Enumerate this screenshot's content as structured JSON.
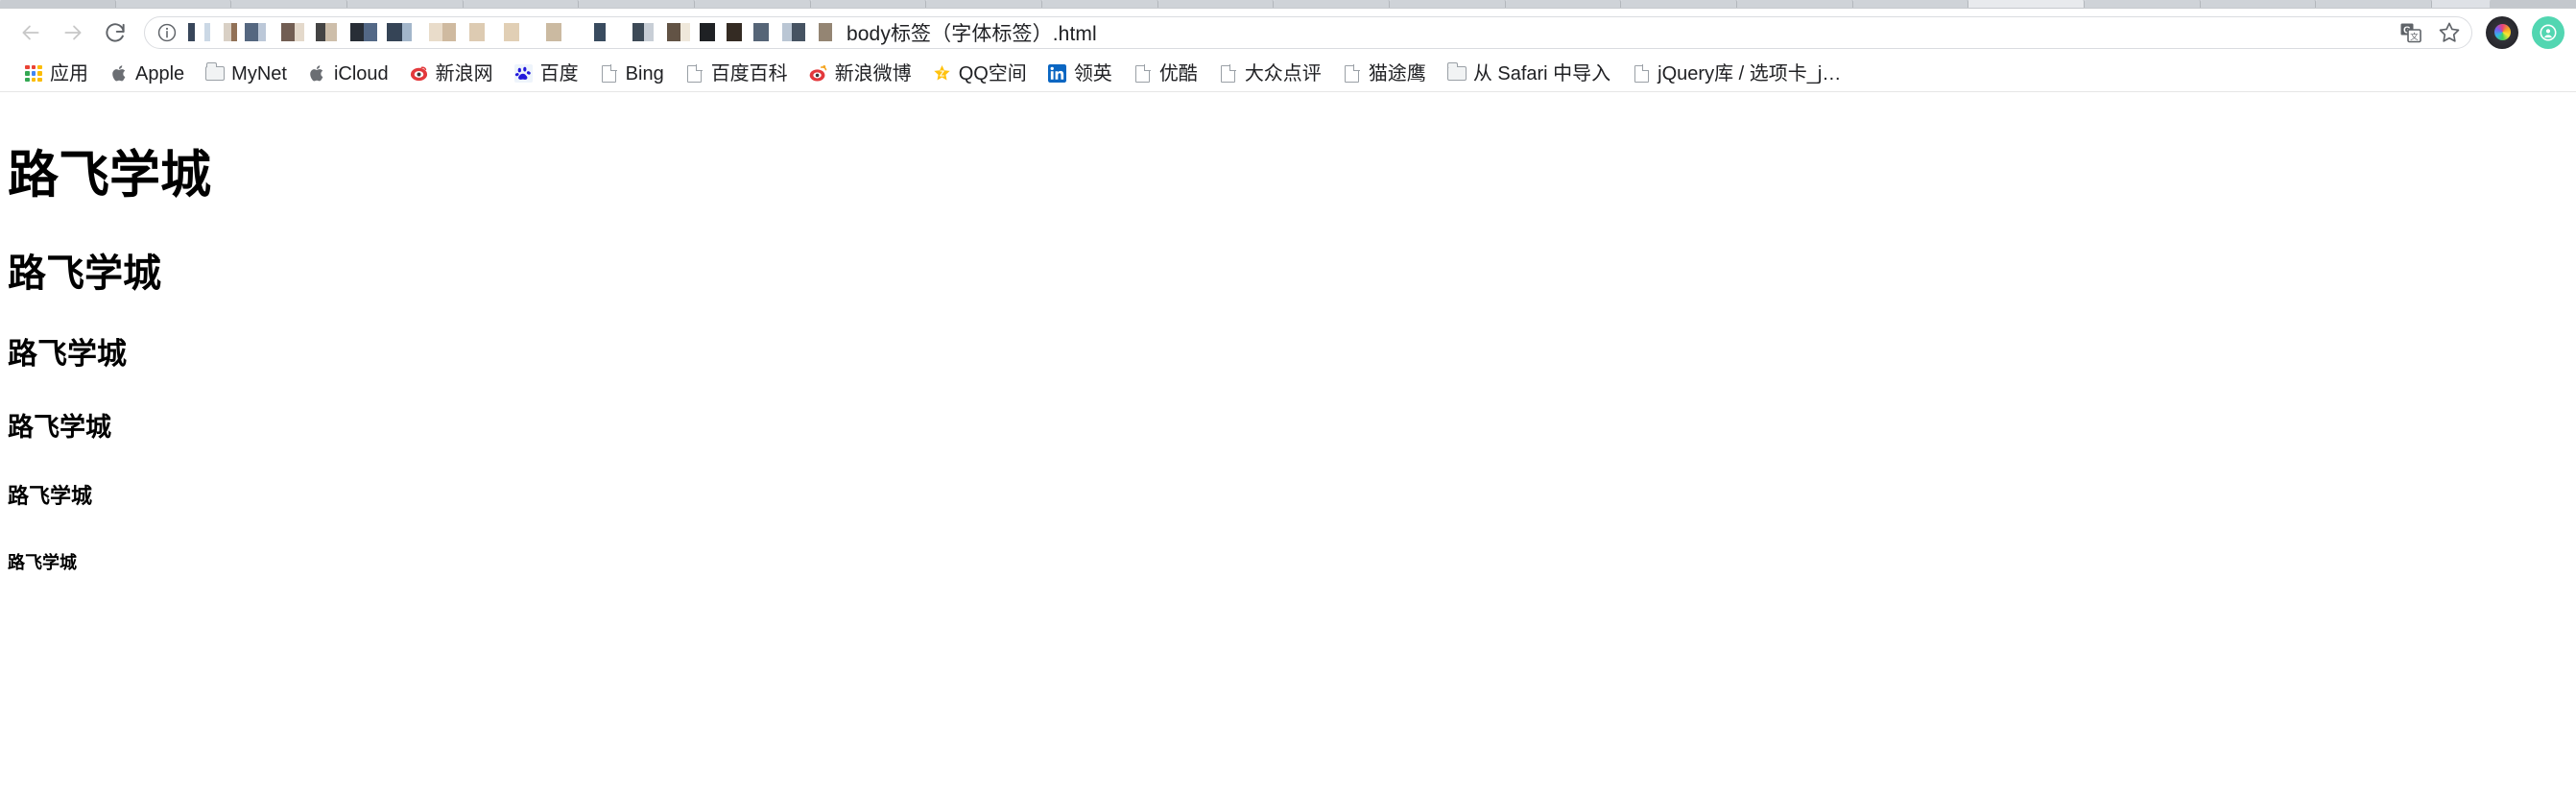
{
  "browser": {
    "window_controls": {
      "back_label": "后退",
      "forward_label": "前进",
      "reload_label": "重新加载此页"
    },
    "omnibox": {
      "site_info_icon": "info-icon",
      "url_visible_text": "body标签（字体标签）.html",
      "url_redacted": true,
      "translate_icon": "translate-icon",
      "bookmark_star_icon": "star-icon"
    },
    "extensions": [
      {
        "name": "lens-extension-icon",
        "color": "#2b2b31"
      },
      {
        "name": "profile-avatar",
        "color": "#52d6b1"
      }
    ],
    "bookmarks": [
      {
        "label": "应用",
        "icon": "apps-grid-icon"
      },
      {
        "label": "Apple",
        "icon": "apple-icon"
      },
      {
        "label": "MyNet",
        "icon": "folder-icon"
      },
      {
        "label": "iCloud",
        "icon": "apple-icon"
      },
      {
        "label": "新浪网",
        "icon": "sina-icon"
      },
      {
        "label": "百度",
        "icon": "baidu-icon"
      },
      {
        "label": "Bing",
        "icon": "page-icon"
      },
      {
        "label": "百度百科",
        "icon": "page-icon"
      },
      {
        "label": "新浪微博",
        "icon": "weibo-icon"
      },
      {
        "label": "QQ空间",
        "icon": "qzone-star-icon"
      },
      {
        "label": "领英",
        "icon": "linkedin-icon"
      },
      {
        "label": "优酷",
        "icon": "page-icon"
      },
      {
        "label": "大众点评",
        "icon": "page-icon"
      },
      {
        "label": "猫途鹰",
        "icon": "page-icon"
      },
      {
        "label": "从 Safari 中导入",
        "icon": "folder-icon"
      },
      {
        "label": "jQuery库 / 选项卡_j…",
        "icon": "page-icon"
      }
    ]
  },
  "page": {
    "headings": [
      {
        "level": "h1",
        "text": "路飞学城"
      },
      {
        "level": "h2",
        "text": "路飞学城"
      },
      {
        "level": "h3",
        "text": "路飞学城"
      },
      {
        "level": "h4",
        "text": "路飞学城"
      },
      {
        "level": "h5",
        "text": "路飞学城"
      },
      {
        "level": "h6",
        "text": "路飞学城"
      }
    ]
  },
  "colors": {
    "chrome_bg": "#ffffff",
    "tabstrip_bg": "#dee1e6",
    "text": "#202124",
    "heading_text": "#000000",
    "avatar_teal": "#52d6b1",
    "linkedin_blue": "#0a66c2",
    "sina_red": "#e3393c",
    "baidu_blue": "#2319dc",
    "qzone_gold": "#ffc20e"
  }
}
